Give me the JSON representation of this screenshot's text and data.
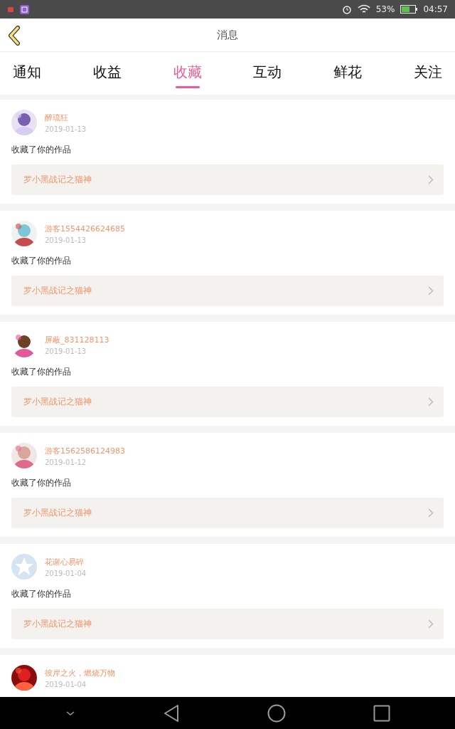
{
  "status_bar": {
    "battery": "53%",
    "time": "04:57"
  },
  "header": {
    "title": "消息"
  },
  "tabs": [
    {
      "label": "通知",
      "selected": false
    },
    {
      "label": "收益",
      "selected": false
    },
    {
      "label": "收藏",
      "selected": true
    },
    {
      "label": "互动",
      "selected": false
    },
    {
      "label": "鲜花",
      "selected": false
    },
    {
      "label": "关注",
      "selected": false
    }
  ],
  "items": [
    {
      "name": "醉琉狂",
      "date": "2019-01-13",
      "action": "收藏了你的作品",
      "work": "罗小黑战记之猫神"
    },
    {
      "name": "游客1554426624685",
      "date": "2019-01-13",
      "action": "收藏了你的作品",
      "work": "罗小黑战记之猫神"
    },
    {
      "name": "屏蔽_831128113",
      "date": "2019-01-13",
      "action": "收藏了你的作品",
      "work": "罗小黑战记之猫神"
    },
    {
      "name": "游客1562586124983",
      "date": "2019-01-12",
      "action": "收藏了你的作品",
      "work": "罗小黑战记之猫神"
    },
    {
      "avatar": {
        "kind": "default"
      },
      "name": "花谢心易碎",
      "date": "2019-01-04",
      "action": "收藏了你的作品",
      "work": "罗小黑战记之猫神"
    },
    {
      "name": "彼岸之火，燃烧万物",
      "date": "2019-01-04"
    }
  ]
}
